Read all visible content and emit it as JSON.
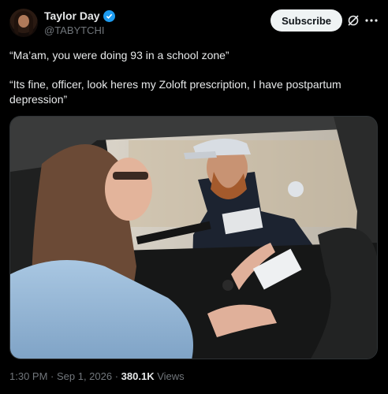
{
  "author": {
    "display_name": "Taylor Day",
    "handle": "@TABYTCHI"
  },
  "actions": {
    "subscribe_label": "Subscribe",
    "grok_icon": "grok-icon",
    "more_icon": "more-icon"
  },
  "tweet": {
    "line1": "“Ma’am, you were doing 93 in a school zone”",
    "line2": "“Its fine, officer, look heres my Zoloft prescription, I have postpartum depression”"
  },
  "meta": {
    "time": "1:30 PM",
    "sep1": " · ",
    "date": "Sep 1, 2026",
    "sep2": " · ",
    "views": "380.1K",
    "views_label": " Views"
  },
  "colors": {
    "background": "#000000",
    "text": "#e7e9ea",
    "secondary": "#71767b",
    "verified": "#1d9bf0"
  }
}
